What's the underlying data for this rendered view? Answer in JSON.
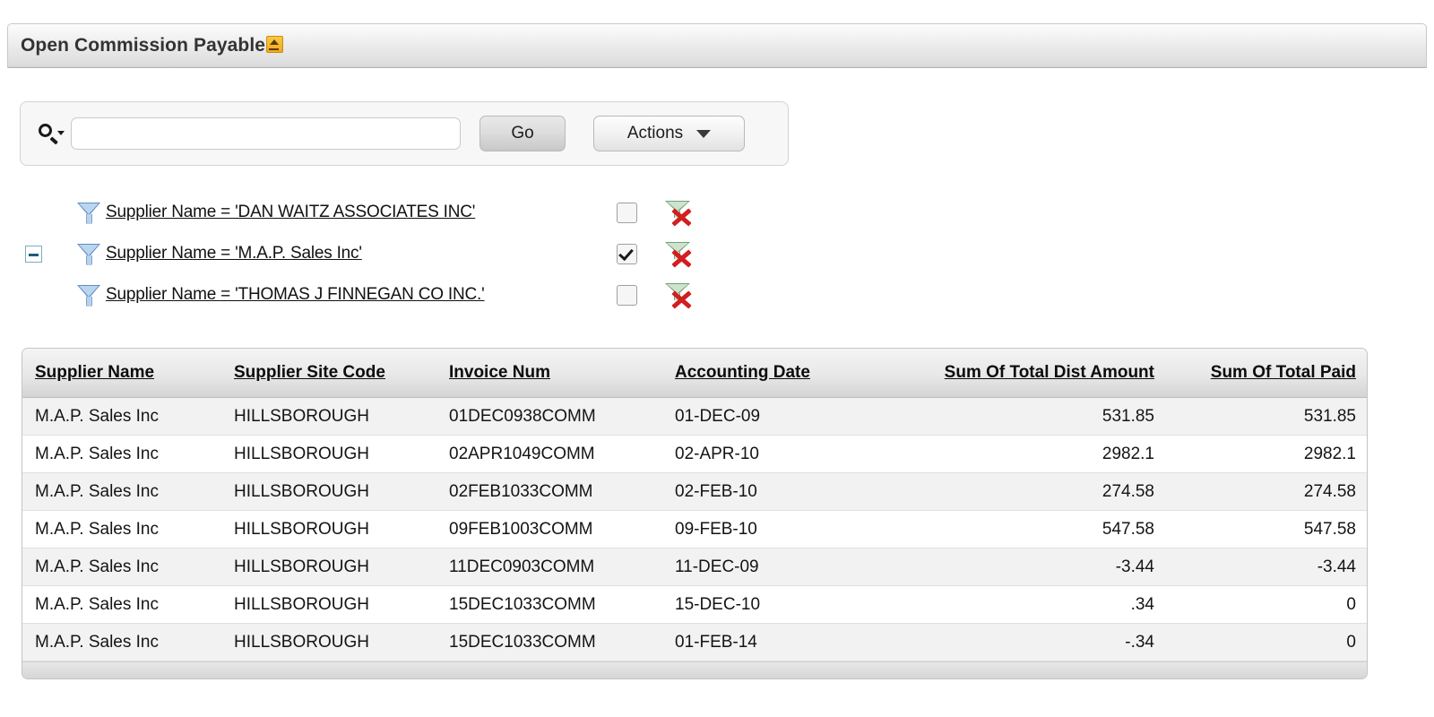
{
  "region": {
    "title": "Open Commission Payable",
    "collapse_icon": "collapse-region-icon"
  },
  "search": {
    "icon": "search-icon",
    "value": "",
    "placeholder": "",
    "go_label": "Go",
    "actions_label": "Actions",
    "actions_caret": "chevron-down-icon"
  },
  "filters": {
    "expand_toggle": "minus-icon",
    "rows": [
      {
        "label": "Supplier Name = 'DAN WAITZ ASSOCIATES INC'",
        "enabled": false,
        "filter_icon": "funnel-icon",
        "remove_icon": "remove-filter-icon"
      },
      {
        "label": "Supplier Name = 'M.A.P. Sales Inc'",
        "enabled": true,
        "filter_icon": "funnel-icon",
        "remove_icon": "remove-filter-icon"
      },
      {
        "label": "Supplier Name = 'THOMAS J FINNEGAN CO INC.'",
        "enabled": false,
        "filter_icon": "funnel-icon",
        "remove_icon": "remove-filter-icon"
      }
    ]
  },
  "report": {
    "columns": [
      {
        "label": "Supplier Name",
        "align": "left"
      },
      {
        "label": "Supplier Site Code",
        "align": "left"
      },
      {
        "label": "Invoice Num",
        "align": "left"
      },
      {
        "label": "Accounting Date",
        "align": "left"
      },
      {
        "label": "Sum Of Total Dist Amount",
        "align": "right"
      },
      {
        "label": "Sum Of Total Paid",
        "align": "right"
      }
    ],
    "rows": [
      [
        "M.A.P. Sales Inc",
        "HILLSBOROUGH",
        "01DEC0938COMM",
        "01-DEC-09",
        "531.85",
        "531.85"
      ],
      [
        "M.A.P. Sales Inc",
        "HILLSBOROUGH",
        "02APR1049COMM",
        "02-APR-10",
        "2982.1",
        "2982.1"
      ],
      [
        "M.A.P. Sales Inc",
        "HILLSBOROUGH",
        "02FEB1033COMM",
        "02-FEB-10",
        "274.58",
        "274.58"
      ],
      [
        "M.A.P. Sales Inc",
        "HILLSBOROUGH",
        "09FEB1003COMM",
        "09-FEB-10",
        "547.58",
        "547.58"
      ],
      [
        "M.A.P. Sales Inc",
        "HILLSBOROUGH",
        "11DEC0903COMM",
        "11-DEC-09",
        "-3.44",
        "-3.44"
      ],
      [
        "M.A.P. Sales Inc",
        "HILLSBOROUGH",
        "15DEC1033COMM",
        "15-DEC-10",
        ".34",
        "0"
      ],
      [
        "M.A.P. Sales Inc",
        "HILLSBOROUGH",
        "15DEC1033COMM",
        "01-FEB-14",
        "-.34",
        "0"
      ]
    ]
  },
  "colors": {
    "accent_orange": "#f0a81e",
    "filter_blue": "#5d8ec4",
    "remove_red": "#d21f1f",
    "row_stripe": "#f2f2f2"
  }
}
